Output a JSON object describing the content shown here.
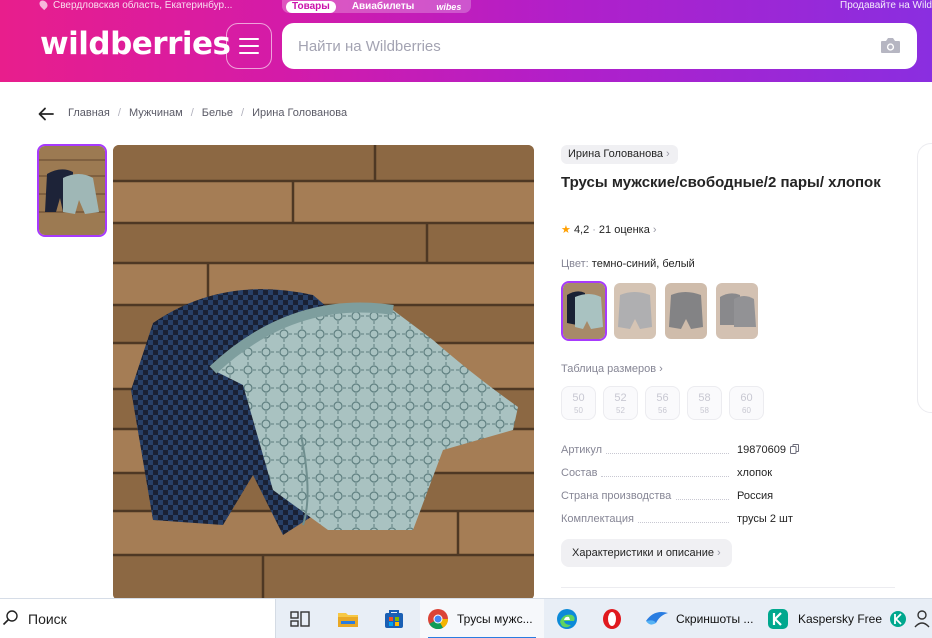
{
  "header": {
    "location": "Свердловская область, Екатеринбур...",
    "tabs": [
      "Товары",
      "Авиабилеты",
      "wibes"
    ],
    "sell_link": "Продавайте на Wild",
    "logo": "wildberries",
    "search_placeholder": "Найти на Wildberries",
    "colors": {
      "gradient_start": "#e81e8c",
      "gradient_end": "#8a2ee0",
      "accent": "#a73afd"
    }
  },
  "breadcrumb": [
    "Главная",
    "Мужчинам",
    "Белье",
    "Ирина Голованова"
  ],
  "product": {
    "seller": "Ирина Голованова",
    "title": "Трусы мужские/свободные/2 пары/ хлопок",
    "rating": "4,2",
    "reviews": "21 оценка",
    "color_label": "Цвет:",
    "color_value": "темно-синий, белый",
    "size_table_label": "Таблица размеров",
    "sizes": [
      {
        "ru": "50",
        "eu": "50"
      },
      {
        "ru": "52",
        "eu": "52"
      },
      {
        "ru": "56",
        "eu": "56"
      },
      {
        "ru": "58",
        "eu": "58"
      },
      {
        "ru": "60",
        "eu": "60"
      }
    ],
    "specs": [
      {
        "key": "Артикул",
        "value": "19870609"
      },
      {
        "key": "Состав",
        "value": "хлопок"
      },
      {
        "key": "Страна производства",
        "value": "Россия"
      },
      {
        "key": "Комплектация",
        "value": "трусы 2 шт"
      }
    ],
    "details_button": "Характеристики и описание"
  },
  "taskbar": {
    "search": "Поиск",
    "apps": [
      {
        "name": "chrome",
        "label": "Трусы мужс..."
      },
      {
        "name": "screenshots",
        "label": "Скриншоты ..."
      },
      {
        "name": "kaspersky",
        "label": "Kaspersky Free"
      }
    ],
    "icons": [
      "task-view-icon",
      "file-explorer-icon",
      "store-icon",
      "chrome-icon",
      "edge-icon",
      "opera-icon",
      "screenshots-icon",
      "kaspersky-icon"
    ]
  }
}
